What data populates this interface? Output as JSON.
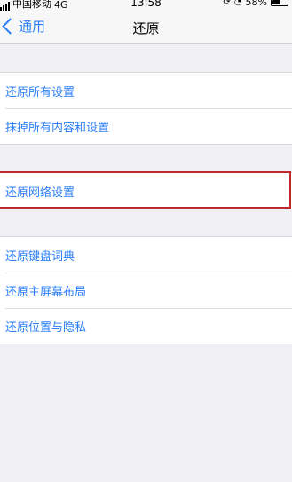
{
  "status_bar": {
    "carrier": "中国移动",
    "network": "4G",
    "time": "13:58",
    "battery_text": "58%",
    "battery_level": 0.58
  },
  "nav": {
    "back_label": "通用",
    "title": "还原"
  },
  "groups": [
    {
      "items": [
        {
          "label": "还原所有设置"
        },
        {
          "label": "抹掉所有内容和设置"
        }
      ]
    },
    {
      "items": [
        {
          "label": "还原网络设置"
        }
      ]
    },
    {
      "items": [
        {
          "label": "还原键盘词典"
        },
        {
          "label": "还原主屏幕布局"
        },
        {
          "label": "还原位置与隐私"
        }
      ]
    }
  ],
  "colors": {
    "accent": "#2a7ff6",
    "highlight_border": "#c0282d",
    "background": "#efeff4"
  }
}
